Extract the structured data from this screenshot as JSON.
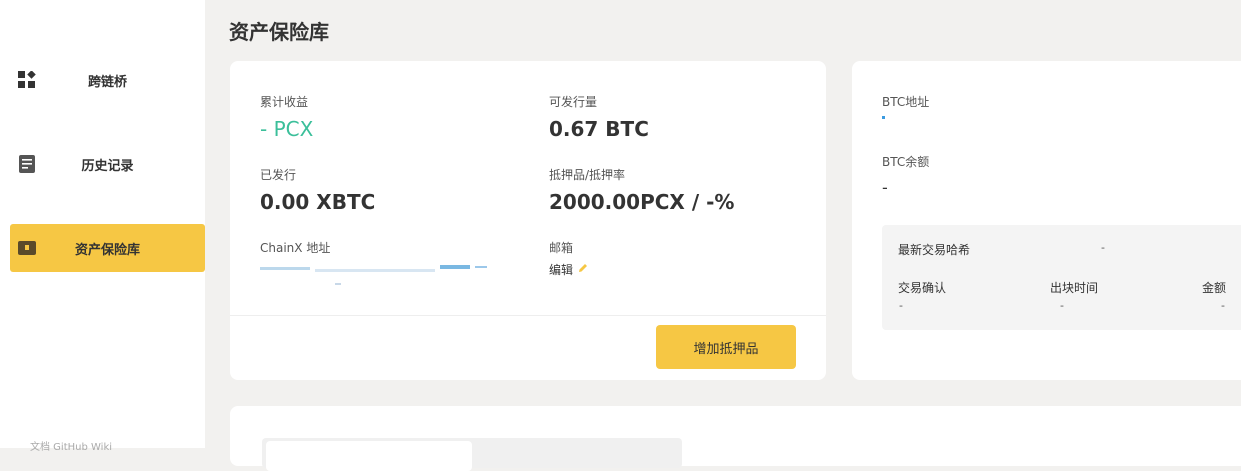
{
  "sidebar": {
    "items": [
      {
        "label": "跨链桥",
        "icon": "grid-icon"
      },
      {
        "label": "历史记录",
        "icon": "document-icon"
      },
      {
        "label": "资产保险库",
        "icon": "vault-icon"
      }
    ],
    "footer": "文档   GitHub   Wiki"
  },
  "page": {
    "title": "资产保险库"
  },
  "vault": {
    "earnings_label": "累计收益",
    "earnings_value": "- PCX",
    "issuable_label": "可发行量",
    "issuable_value": "0.67 BTC",
    "issued_label": "已发行",
    "issued_value": "0.00 XBTC",
    "collateral_label": "抵押品/抵押率",
    "collateral_value": "2000.00PCX / -%",
    "address_label": "ChainX 地址",
    "email_label": "邮箱",
    "email_edit": "编辑",
    "add_collateral_button": "增加抵押品"
  },
  "btc": {
    "address_label": "BTC地址",
    "balance_label": "BTC余额",
    "balance_value": "-",
    "latest_tx_label": "最新交易哈希",
    "latest_tx_value": "-",
    "confirm_label": "交易确认",
    "confirm_value": "-",
    "block_time_label": "出块时间",
    "block_time_value": "-",
    "amount_label": "金额",
    "amount_value": "-"
  },
  "colors": {
    "accent": "#f6c744",
    "green": "#3bbf9a",
    "background": "#f2f1ef"
  }
}
